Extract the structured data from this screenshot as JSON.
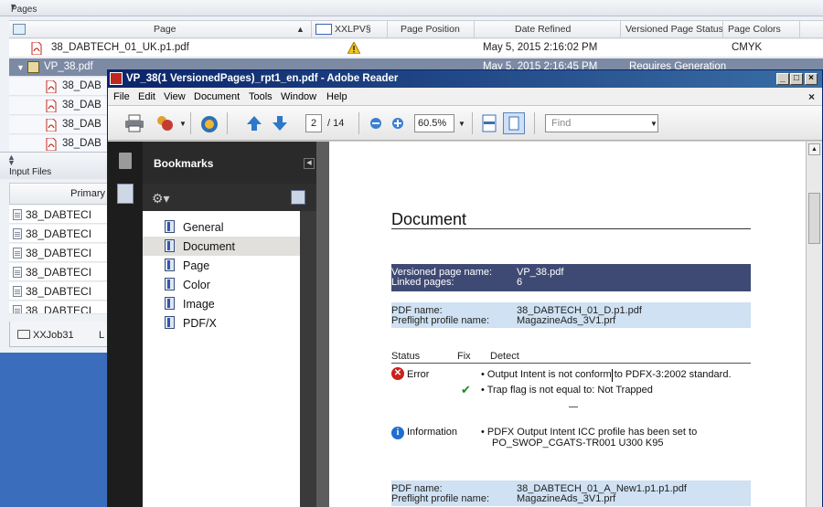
{
  "background_app": {
    "pages_section_label": "Pages",
    "grid_headers": {
      "page": "Page",
      "xxlpv": "XXLPV§",
      "page_position": "Page Position",
      "date_refined": "Date Refined",
      "versioned_page_status": "Versioned Page Status",
      "page_colors": "Page Colors"
    },
    "rows": [
      {
        "name": "38_DABTECH_01_UK.p1.pdf",
        "date": "May 5, 2015 2:16:02 PM",
        "colors": "CMYK"
      },
      {
        "name": "VP_38.pdf",
        "date": "May 5, 2015 2:16:45 PM",
        "status": "Requires Generation"
      }
    ],
    "child_rows": [
      "38_DAB",
      "38_DAB",
      "38_DAB",
      "38_DAB"
    ],
    "input_files_label": "Input Files",
    "input_files_column": "Primary",
    "input_files": [
      "38_DABTECI",
      "38_DABTECI",
      "38_DABTECI",
      "38_DABTECI",
      "38_DABTECI",
      "38_DABTECI"
    ],
    "job_tab": "XXJob31",
    "job_tab_trail": "L"
  },
  "reader": {
    "title": "VP_38(1 VersionedPages)_rpt1_en.pdf - Adobe Reader",
    "menu": [
      "File",
      "Edit",
      "View",
      "Document",
      "Tools",
      "Window",
      "Help"
    ],
    "menu_close": "×",
    "toolbar": {
      "current_page": "2",
      "page_total": "/ 14",
      "zoom": "60.5%",
      "find_placeholder": "Find"
    },
    "bookmarks": {
      "title": "Bookmarks",
      "items": [
        "General",
        "Document",
        "Page",
        "Color",
        "Image",
        "PDF/X"
      ],
      "selected": "Document"
    },
    "document": {
      "heading": "Document",
      "versioned_label": "Versioned page name:",
      "versioned_value": "VP_38.pdf",
      "linked_label": "Linked pages:",
      "linked_value": "6",
      "pdf1_label": "PDF name:",
      "pdf1_value": "38_DABTECH_01_D.p1.pdf",
      "profile1_label": "Preflight profile name:",
      "profile1_value": "MagazineAds_3V1.prf",
      "col_status": "Status",
      "col_fix": "Fix",
      "col_detect": "Detect",
      "err_status": "Error",
      "err_detect_1": "•  Output Intent is not conform to PDFX-3:2002 standard.",
      "err_detect_2": "•  Trap flag is not equal to: Not Trapped",
      "info_status": "Information",
      "info_detect_1": "•  PDFX Output Intent ICC profile has been set to",
      "info_detect_2": "PO_SWOP_CGATS-TR001 U300 K95",
      "pdf2_label": "PDF name:",
      "pdf2_value": "38_DABTECH_01_A_New1.p1.p1.pdf",
      "profile2_label": "Preflight profile name:",
      "profile2_value": "MagazineAds_3V1.prf"
    }
  }
}
